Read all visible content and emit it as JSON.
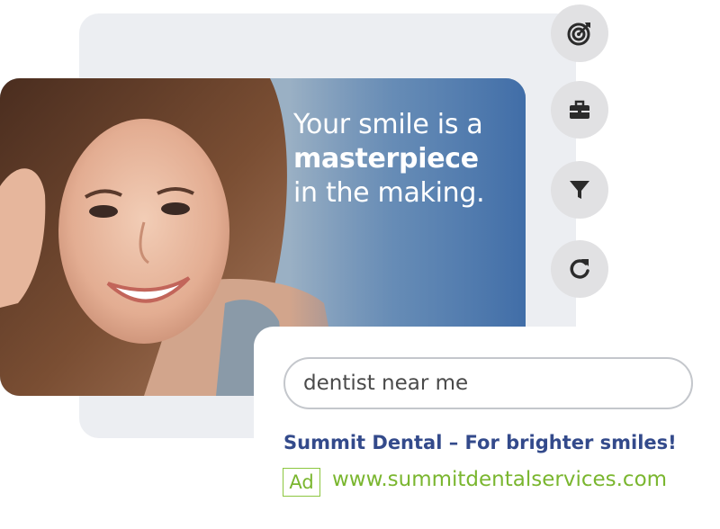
{
  "hero": {
    "headline_line1": "Your smile is a",
    "headline_line2": "masterpiece",
    "headline_line3": "in the making."
  },
  "side_icons": [
    {
      "icon": "target-icon"
    },
    {
      "icon": "toolbox-icon"
    },
    {
      "icon": "filter-icon"
    },
    {
      "icon": "refresh-icon"
    }
  ],
  "search": {
    "query": "dentist near me"
  },
  "ad": {
    "title": "Summit Dental – For brighter smiles!",
    "badge": "Ad",
    "url": "www.summitdentalservices.com"
  },
  "colors": {
    "panel": "#eceef2",
    "hero_blue": "#3f6ea8",
    "icon_bg": "#e1e1e3",
    "ad_title": "#334a8b",
    "ad_green": "#7ab62f"
  }
}
